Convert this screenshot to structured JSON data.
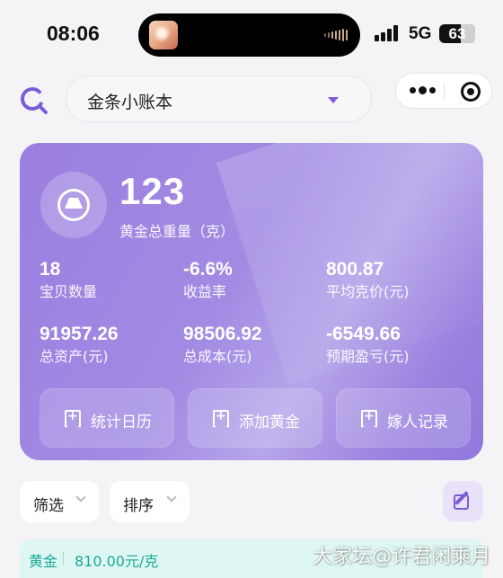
{
  "status_bar": {
    "time": "08:06",
    "network": "5G",
    "battery": "63"
  },
  "nav": {
    "app_title": "金条小账本"
  },
  "summary": {
    "total_weight": "123",
    "total_weight_label": "黄金总重量（克）",
    "stats": [
      {
        "value": "18",
        "label": "宝贝数量"
      },
      {
        "value": "-6.6%",
        "label": "收益率"
      },
      {
        "value": "800.87",
        "label": "平均克价(元)"
      },
      {
        "value": "91957.26",
        "label": "总资产(元)"
      },
      {
        "value": "98506.92",
        "label": "总成本(元)"
      },
      {
        "value": "-6549.66",
        "label": "预期盈亏(元)"
      }
    ],
    "actions": [
      {
        "label": "统计日历",
        "icon": "bookmark-plus-icon"
      },
      {
        "label": "添加黄金",
        "icon": "bookmark-plus-icon"
      },
      {
        "label": "嫁人记录",
        "icon": "bookmark-plus-icon"
      }
    ]
  },
  "filters": {
    "filter_label": "筛选",
    "sort_label": "排序",
    "edit_icon": "edit-icon"
  },
  "price_strip": {
    "tag": "黄金",
    "price": "810.00元/克"
  },
  "watermark": "大家坛@许君闲乘月",
  "colors": {
    "accent": "#7c5cd6",
    "card_gradient_start": "#9b7fe0",
    "price_text": "#1aa897",
    "price_bg": "#dff7f3"
  }
}
